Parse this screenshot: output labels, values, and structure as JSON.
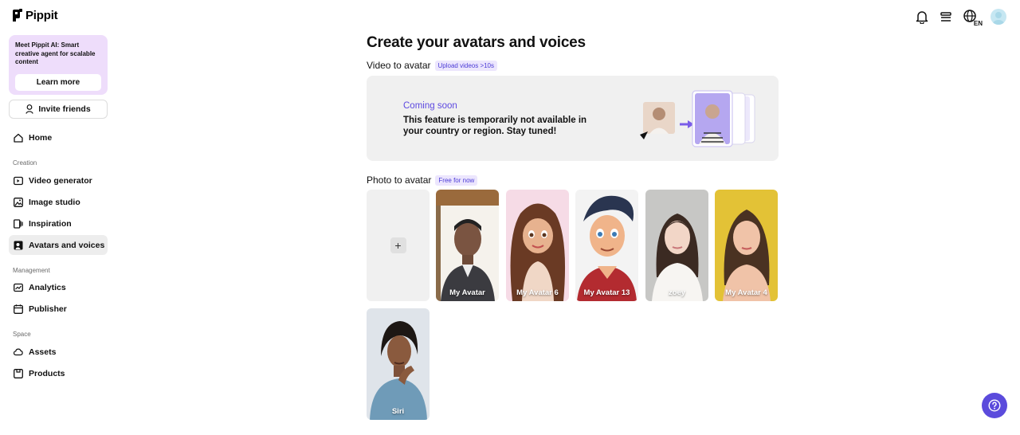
{
  "app": {
    "name": "Pippit"
  },
  "header": {
    "language": "EN",
    "icons": [
      "bell-icon",
      "layers-icon",
      "globe-icon",
      "user-avatar"
    ]
  },
  "sidebar": {
    "promo": {
      "text": "Meet Pippit AI: Smart creative agent for scalable content",
      "button": "Learn more"
    },
    "invite": "Invite friends",
    "home": "Home",
    "sections": [
      {
        "label": "Creation",
        "items": [
          "Video generator",
          "Image studio",
          "Inspiration",
          "Avatars and voices"
        ]
      },
      {
        "label": "Management",
        "items": [
          "Analytics",
          "Publisher"
        ]
      },
      {
        "label": "Space",
        "items": [
          "Assets",
          "Products"
        ]
      }
    ]
  },
  "main": {
    "title": "Create your avatars and voices",
    "video_section": {
      "title": "Video to avatar",
      "tag": "Upload videos >10s",
      "coming_soon": "Coming soon",
      "message": "This feature is temporarily not available in your country or region. Stay tuned!"
    },
    "photo_section": {
      "title": "Photo to avatar",
      "tag": "Free for now",
      "avatars": [
        {
          "name": "My Avatar"
        },
        {
          "name": "My Avatar 6"
        },
        {
          "name": "My Avatar 13"
        },
        {
          "name": "zoey"
        },
        {
          "name": "My Avatar 4"
        },
        {
          "name": "Siri"
        }
      ]
    }
  },
  "colors": {
    "accent": "#5b4bdc",
    "promo_bg": "#eeddfb",
    "tag_bg": "#ece6fd",
    "coming_soon": "#5d49e0"
  }
}
